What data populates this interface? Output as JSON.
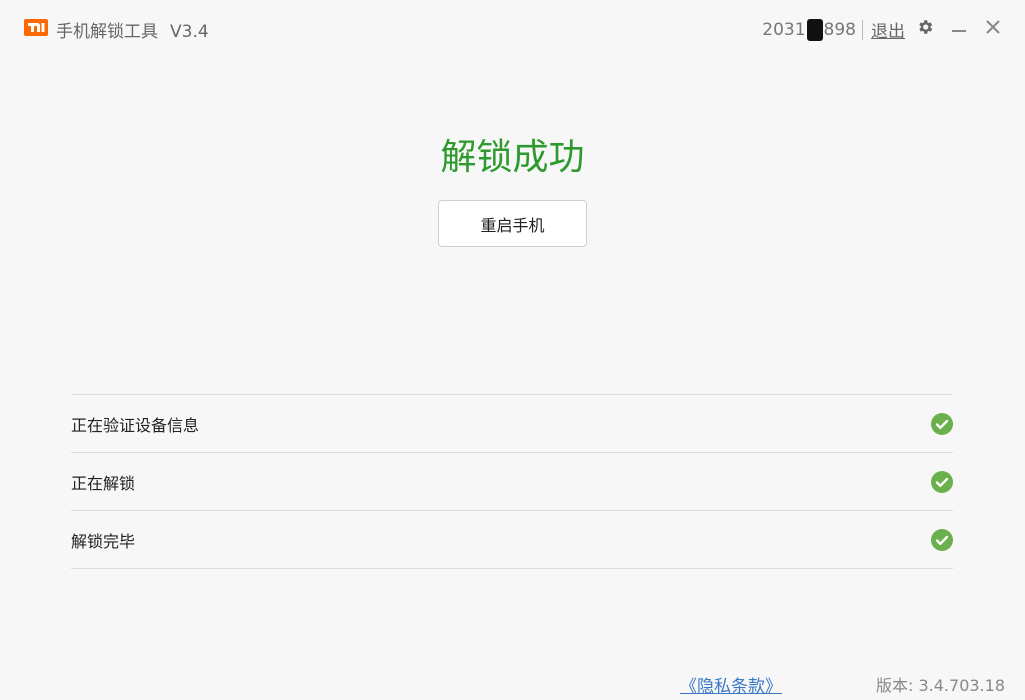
{
  "titlebar": {
    "logo_text": "MI",
    "app_name": "手机解锁工具",
    "version_label": "V3.4",
    "account_prefix": "2031",
    "account_suffix": "898",
    "logout_label": "退出",
    "icons": [
      "settings-icon",
      "minimize-icon",
      "close-icon"
    ]
  },
  "main": {
    "result_title": "解锁成功",
    "reboot_label": "重启手机"
  },
  "steps": [
    {
      "label": "正在验证设备信息",
      "status": "done"
    },
    {
      "label": "正在解锁",
      "status": "done"
    },
    {
      "label": "解锁完毕",
      "status": "done"
    }
  ],
  "footer": {
    "privacy_label": "《隐私条款》",
    "version_text": "版本: 3.4.703.18"
  },
  "colors": {
    "brand": "#ff6700",
    "success": "#2e9a2e",
    "check": "#6ab04c",
    "link": "#3a78c7"
  }
}
